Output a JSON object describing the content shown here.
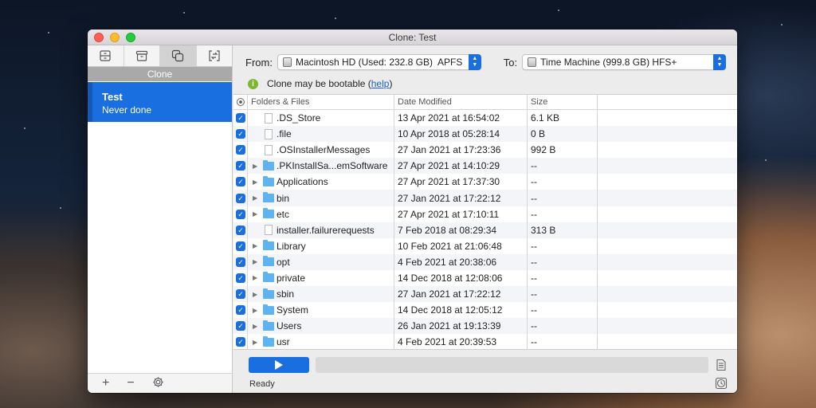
{
  "window": {
    "title": "Clone: Test"
  },
  "sidebar": {
    "tabs": [
      {
        "name": "drawer-tab",
        "icon": "drawer-icon",
        "active": false
      },
      {
        "name": "archive-tab",
        "icon": "archive-box-icon",
        "active": false
      },
      {
        "name": "clone-tab",
        "icon": "clone-icon",
        "active": true
      },
      {
        "name": "sync-tab",
        "icon": "sync-icon",
        "active": false
      }
    ],
    "caption": "Clone",
    "task": {
      "name": "Test",
      "status": "Never done"
    },
    "footer": {
      "add": "+",
      "remove": "−"
    }
  },
  "source": {
    "from_label": "From:",
    "from_value": "Macintosh HD (Used: 232.8 GB)  APFS",
    "to_label": "To:",
    "to_value": "Time Machine (999.8 GB) HFS+"
  },
  "info": {
    "icon": "i",
    "text": "Clone may be bootable (",
    "link": "help",
    "suffix": ")"
  },
  "table": {
    "columns": [
      "Folders & Files",
      "Date Modified",
      "Size"
    ],
    "rows": [
      {
        "name": ".DS_Store",
        "date": "13 Apr 2021 at 16:54:02",
        "size": "6.1 KB",
        "folder": false
      },
      {
        "name": ".file",
        "date": "10 Apr 2018 at 05:28:14",
        "size": "0 B",
        "folder": false
      },
      {
        "name": ".OSInstallerMessages",
        "date": "27 Jan 2021 at 17:23:36",
        "size": "992 B",
        "folder": false
      },
      {
        "name": ".PKInstallSa...emSoftware",
        "date": "27 Apr 2021 at 14:10:29",
        "size": "--",
        "folder": true
      },
      {
        "name": "Applications",
        "date": "27 Apr 2021 at 17:37:30",
        "size": "--",
        "folder": true
      },
      {
        "name": "bin",
        "date": "27 Jan 2021 at 17:22:12",
        "size": "--",
        "folder": true
      },
      {
        "name": "etc",
        "date": "27 Apr 2021 at 17:10:11",
        "size": "--",
        "folder": true
      },
      {
        "name": "installer.failurerequests",
        "date": "7 Feb 2018 at 08:29:34",
        "size": "313 B",
        "folder": false
      },
      {
        "name": "Library",
        "date": "10 Feb 2021 at 21:06:48",
        "size": "--",
        "folder": true
      },
      {
        "name": "opt",
        "date": "4 Feb 2021 at 20:38:06",
        "size": "--",
        "folder": true
      },
      {
        "name": "private",
        "date": "14 Dec 2018 at 12:08:06",
        "size": "--",
        "folder": true
      },
      {
        "name": "sbin",
        "date": "27 Jan 2021 at 17:22:12",
        "size": "--",
        "folder": true
      },
      {
        "name": "System",
        "date": "14 Dec 2018 at 12:05:12",
        "size": "--",
        "folder": true
      },
      {
        "name": "Users",
        "date": "26 Jan 2021 at 19:13:39",
        "size": "--",
        "folder": true
      },
      {
        "name": "usr",
        "date": "4 Feb 2021 at 20:39:53",
        "size": "--",
        "folder": true
      }
    ]
  },
  "bottom": {
    "status": "Ready",
    "progress": 0
  },
  "colors": {
    "accent": "#1a6fe0",
    "folder": "#5fb4ef",
    "info_green": "#7cb82f"
  }
}
